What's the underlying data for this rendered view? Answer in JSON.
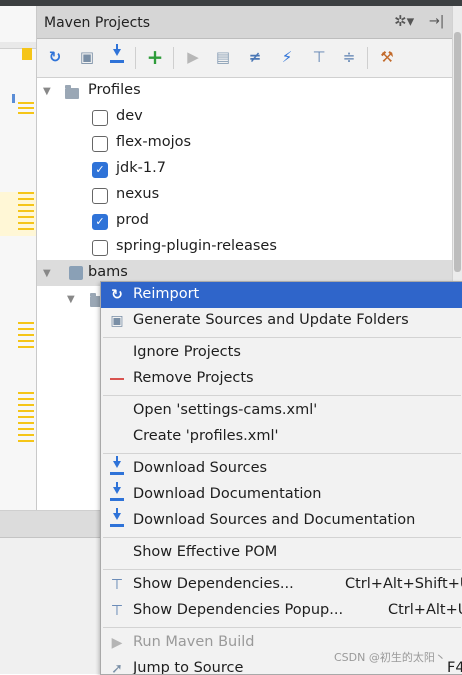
{
  "panel": {
    "title": "Maven Projects",
    "header_icons": [
      "gear-icon",
      "hide-icon"
    ]
  },
  "toolbar": {
    "buttons": [
      "reimport-icon",
      "generate-sources-icon",
      "download-icon",
      "add-icon",
      "run-icon",
      "execute-goal-icon",
      "toggle-offline-icon",
      "skip-tests-icon",
      "show-dependencies-icon",
      "collapse-all-icon",
      "settings-icon"
    ]
  },
  "tree": {
    "profiles_label": "Profiles",
    "profiles": [
      {
        "name": "dev",
        "checked": false
      },
      {
        "name": "flex-mojos",
        "checked": false
      },
      {
        "name": "jdk-1.7",
        "checked": true
      },
      {
        "name": "nexus",
        "checked": false
      },
      {
        "name": "prod",
        "checked": true
      },
      {
        "name": "spring-plugin-releases",
        "checked": false
      }
    ],
    "project_label": "bams"
  },
  "menu": {
    "reimport": "Reimport",
    "generate": "Generate Sources and Update Folders",
    "ignore": "Ignore Projects",
    "remove": "Remove Projects",
    "open_settings": "Open 'settings-cams.xml'",
    "create_profiles": "Create 'profiles.xml'",
    "download_sources": "Download Sources",
    "download_docs": "Download Documentation",
    "download_both": "Download Sources and Documentation",
    "effective_pom": "Show Effective POM",
    "show_deps": "Show Dependencies...",
    "show_deps_shortcut": "Ctrl+Alt+Shift+U",
    "show_deps_popup": "Show Dependencies Popup...",
    "show_deps_popup_shortcut": "Ctrl+Alt+U",
    "run_build": "Run Maven Build",
    "jump_source": "Jump to Source",
    "jump_shortcut": "F4"
  },
  "colors": {
    "selection": "#2f65ca",
    "checkbox": "#2f73d8",
    "remove_red": "#d9534f"
  },
  "watermark": "CSDN @初生的太阳丶"
}
